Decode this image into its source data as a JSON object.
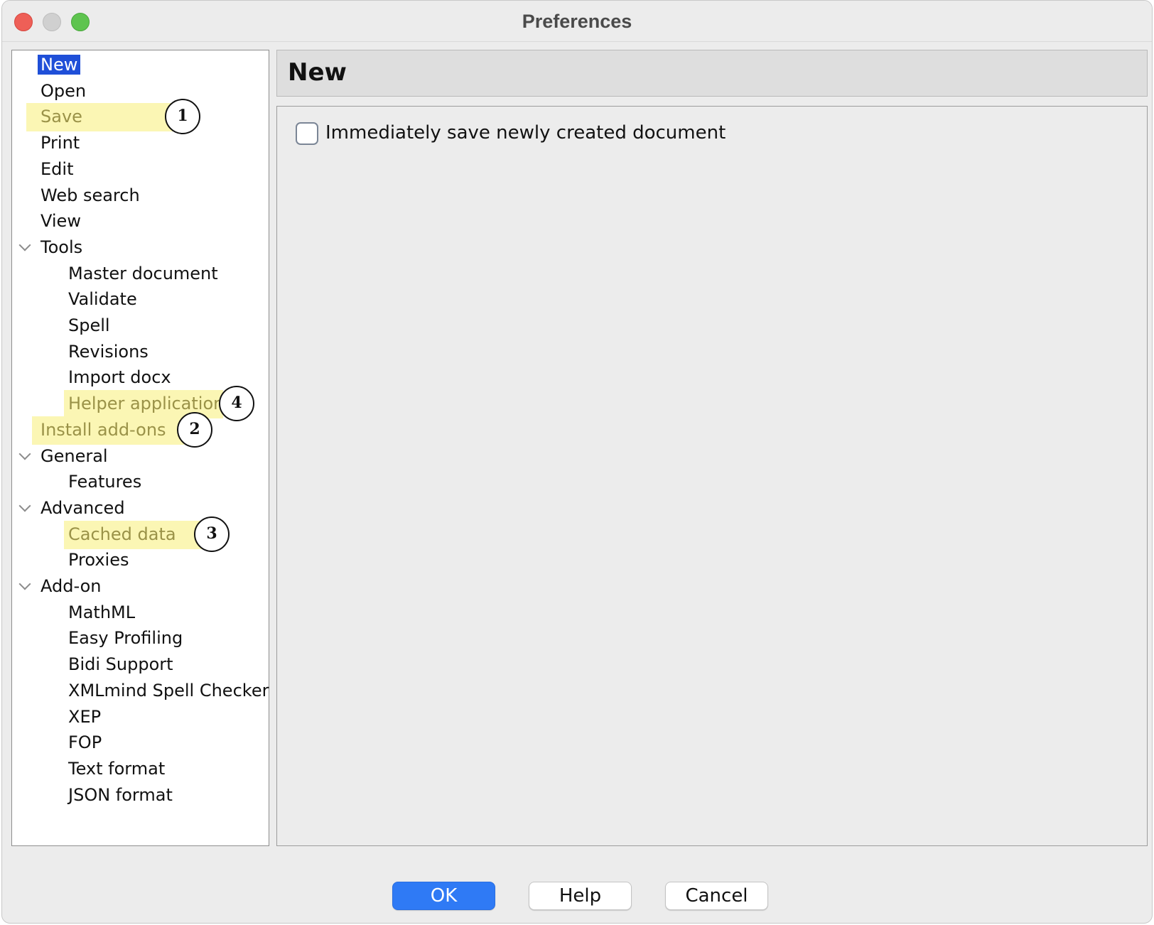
{
  "window": {
    "title": "Preferences"
  },
  "tree": {
    "items": [
      {
        "label": "New",
        "level": 0,
        "selected": true
      },
      {
        "label": "Open",
        "level": 0
      },
      {
        "label": "Save",
        "level": 0,
        "highlighted": true,
        "callout": "1"
      },
      {
        "label": "Print",
        "level": 0
      },
      {
        "label": "Edit",
        "level": 0
      },
      {
        "label": "Web search",
        "level": 0
      },
      {
        "label": "View",
        "level": 0
      },
      {
        "label": "Tools",
        "level": 0,
        "expandable": true
      },
      {
        "label": "Master document",
        "level": 1
      },
      {
        "label": "Validate",
        "level": 1
      },
      {
        "label": "Spell",
        "level": 1
      },
      {
        "label": "Revisions",
        "level": 1
      },
      {
        "label": "Import docx",
        "level": 1
      },
      {
        "label": "Helper applications",
        "level": 1,
        "highlighted": true,
        "callout": "4"
      },
      {
        "label": "Install add-ons",
        "level": 0,
        "highlighted": true,
        "callout": "2"
      },
      {
        "label": "General",
        "level": 0,
        "expandable": true
      },
      {
        "label": "Features",
        "level": 1
      },
      {
        "label": "Advanced",
        "level": 0,
        "expandable": true
      },
      {
        "label": "Cached data",
        "level": 1,
        "highlighted": true,
        "callout": "3"
      },
      {
        "label": "Proxies",
        "level": 1
      },
      {
        "label": "Add-on",
        "level": 0,
        "expandable": true
      },
      {
        "label": "MathML",
        "level": 1
      },
      {
        "label": "Easy Profiling",
        "level": 1
      },
      {
        "label": "Bidi Support",
        "level": 1
      },
      {
        "label": "XMLmind Spell Checker",
        "level": 1
      },
      {
        "label": "XEP",
        "level": 1
      },
      {
        "label": "FOP",
        "level": 1
      },
      {
        "label": "Text format",
        "level": 1
      },
      {
        "label": "JSON format",
        "level": 1
      }
    ]
  },
  "panel": {
    "title": "New",
    "checkbox_label": "Immediately save newly created document",
    "checkbox_checked": false
  },
  "buttons": {
    "ok": "OK",
    "help": "Help",
    "cancel": "Cancel"
  },
  "colors": {
    "selection": "#1f4fd8",
    "highlight": "#fbf6b4",
    "ok_button": "#2f7af5"
  }
}
